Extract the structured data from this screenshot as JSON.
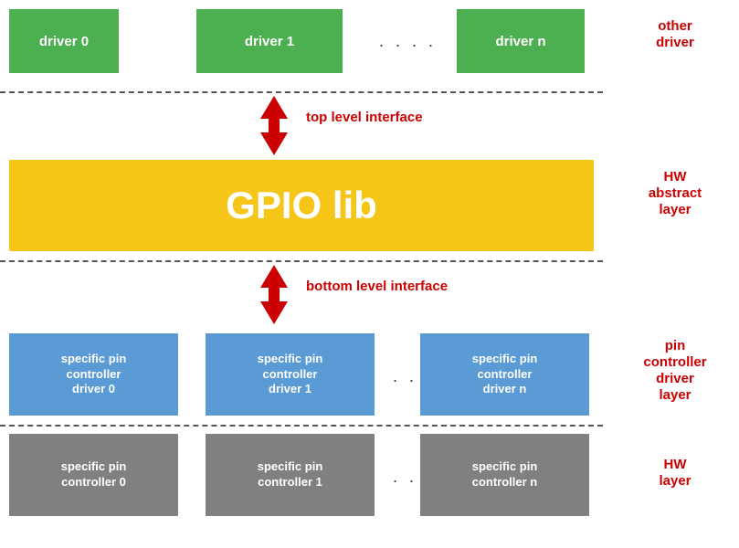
{
  "layers": {
    "other_driver_label": "other\ndriver",
    "hw_abstract_label": "HW\nabstract\nlayer",
    "pin_controller_driver_label": "pin\ncontroller\ndriver\nlayer",
    "hw_layer_label": "HW\nlayer"
  },
  "drivers": {
    "driver0": "driver 0",
    "driver1": "driver 1",
    "driverN": "driver n",
    "dots1": ". . . ."
  },
  "gpio": {
    "label": "GPIO lib"
  },
  "interfaces": {
    "top": "top level interface",
    "bottom": "bottom level interface"
  },
  "pin_ctrl_drivers": {
    "item0": "specific pin\ncontroller\ndriver 0",
    "item1": "specific pin\ncontroller\ndriver 1",
    "itemN": "specific pin\ncontroller\ndriver n",
    "dots": ". . . ."
  },
  "hw_controllers": {
    "item0": "specific pin\ncontroller 0",
    "item1": "specific pin\ncontroller 1",
    "itemN": "specific pin\ncontroller n",
    "dots": ". . . ."
  }
}
